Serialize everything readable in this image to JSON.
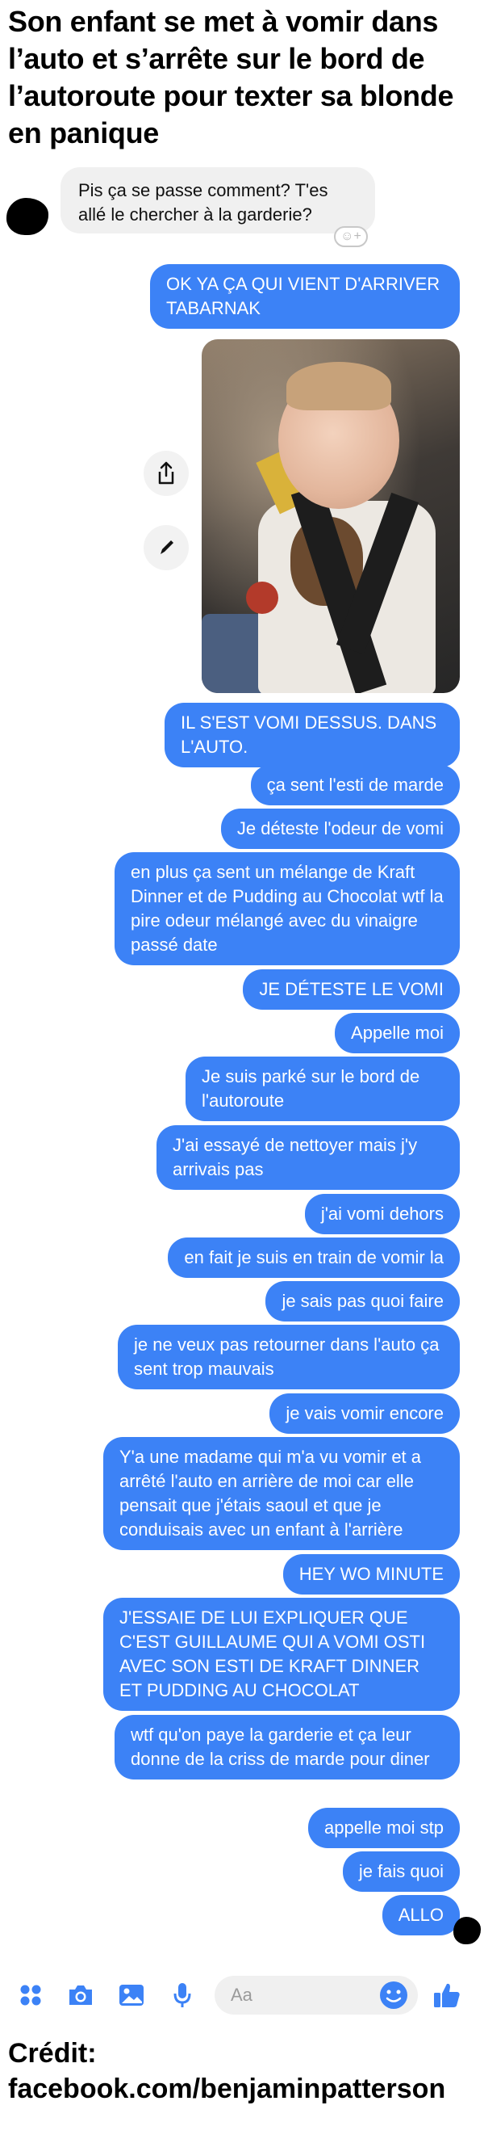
{
  "headline": "Son enfant se met à vomir dans l’auto et s’arrête sur le bord de l’autoroute pour texter sa blonde en panique",
  "incoming_message": "Pis ça se passe comment? T'es allé le chercher à la garderie?",
  "outgoing_messages": [
    "OK YA ÇA QUI VIENT D'ARRIVER TABARNAK",
    "IL S'EST VOMI DESSUS. DANS L'AUTO.",
    "ça sent l'esti de marde",
    "Je déteste l'odeur de vomi",
    "en plus ça sent un mélange de Kraft Dinner et de Pudding au Chocolat wtf la pire odeur mélangé avec du vinaigre passé date",
    "JE DÉTESTE LE VOMI",
    "Appelle moi",
    "Je suis parké sur le bord de l'autoroute",
    "J'ai essayé de nettoyer mais j'y arrivais pas",
    "j'ai vomi dehors",
    "en fait je suis en train de vomir la",
    "je sais pas quoi faire",
    "je ne veux pas retourner dans l'auto ça sent trop mauvais",
    "je vais vomir encore",
    "Y'a une madame qui m'a vu vomir et a arrêté l'auto en arrière de moi car elle pensait que j'étais saoul et que je conduisais avec un enfant à l'arrière",
    "HEY WO MINUTE",
    "J'ESSAIE DE LUI EXPLIQUER QUE C'EST GUILLAUME QUI A VOMI OSTI AVEC SON ESTI DE KRAFT DINNER ET PUDDING AU CHOCOLAT",
    "wtf qu'on paye la garderie et ça leur donne de la criss de marde pour diner",
    "appelle moi stp",
    "je fais quoi",
    "ALLO"
  ],
  "composer": {
    "placeholder": "Aa",
    "icons": [
      "apps-icon",
      "camera-icon",
      "gallery-icon",
      "mic-icon",
      "emoji-icon",
      "thumbs-up-icon"
    ]
  },
  "credit": {
    "label": "Crédit:",
    "source": "facebook.com/benjaminpatterson"
  },
  "colors": {
    "outgoing_bubble": "#3c82f6",
    "incoming_bubble": "#f0f0f0",
    "icon_blue": "#3c82f6"
  }
}
